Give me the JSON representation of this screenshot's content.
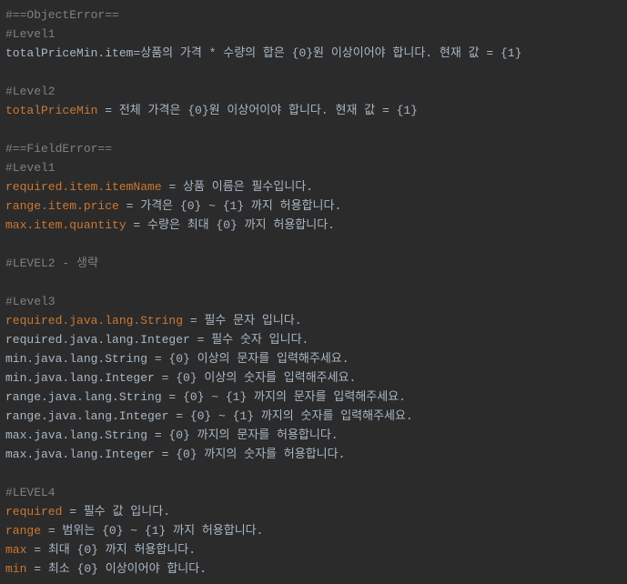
{
  "lines": [
    {
      "segments": [
        {
          "t": "#==ObjectError==",
          "c": "comment"
        }
      ]
    },
    {
      "segments": [
        {
          "t": "#Level1",
          "c": "comment"
        }
      ]
    },
    {
      "segments": [
        {
          "t": "totalPriceMin.item",
          "c": "string"
        },
        {
          "t": "=",
          "c": "string"
        },
        {
          "t": "상품의 가격 * 수량의 합은 {0}원 이상이어야 합니다. 현재 값 = {1}",
          "c": "string"
        }
      ]
    },
    {
      "segments": []
    },
    {
      "segments": [
        {
          "t": "#Level2",
          "c": "comment"
        }
      ]
    },
    {
      "segments": [
        {
          "t": "totalPriceMin",
          "c": "key"
        },
        {
          "t": " = ",
          "c": "string"
        },
        {
          "t": "전체 가격은 {0}원 이상어이야 합니다. 현재 값 = {1}",
          "c": "string"
        }
      ]
    },
    {
      "segments": []
    },
    {
      "segments": [
        {
          "t": "#==FieldError==",
          "c": "comment"
        }
      ]
    },
    {
      "segments": [
        {
          "t": "#Level1",
          "c": "comment"
        }
      ]
    },
    {
      "segments": [
        {
          "t": "required.item.itemName",
          "c": "key"
        },
        {
          "t": " = ",
          "c": "string"
        },
        {
          "t": "상품 이름은 필수입니다.",
          "c": "string"
        }
      ]
    },
    {
      "segments": [
        {
          "t": "range.item.price",
          "c": "key"
        },
        {
          "t": " = ",
          "c": "string"
        },
        {
          "t": "가격은 {0} ~ {1} 까지 허용합니다.",
          "c": "string"
        }
      ]
    },
    {
      "segments": [
        {
          "t": "max.item.quantity",
          "c": "key"
        },
        {
          "t": " = ",
          "c": "string"
        },
        {
          "t": "수량은 최대 {0} 까지 허용합니다.",
          "c": "string"
        }
      ]
    },
    {
      "segments": []
    },
    {
      "segments": [
        {
          "t": "#LEVEL2 - 생략",
          "c": "comment"
        }
      ]
    },
    {
      "segments": []
    },
    {
      "segments": [
        {
          "t": "#Level3",
          "c": "comment"
        }
      ]
    },
    {
      "segments": [
        {
          "t": "required.java.lang.String",
          "c": "key"
        },
        {
          "t": " = ",
          "c": "string"
        },
        {
          "t": "필수 문자 입니다.",
          "c": "string"
        }
      ]
    },
    {
      "segments": [
        {
          "t": "required.java.lang.Integer = 필수 숫자 입니다.",
          "c": "string"
        }
      ]
    },
    {
      "segments": [
        {
          "t": "min.java.lang.String = {0} 이상의 문자를 입력해주세요.",
          "c": "string"
        }
      ]
    },
    {
      "segments": [
        {
          "t": "min.java.lang.Integer = {0} 이상의 숫자를 입력해주세요.",
          "c": "string"
        }
      ]
    },
    {
      "segments": [
        {
          "t": "range.java.lang.String = {0} ~ {1} 까지의 문자를 입력해주세요.",
          "c": "string"
        }
      ]
    },
    {
      "segments": [
        {
          "t": "range.java.lang.Integer = {0} ~ {1} 까지의 숫자를 입력해주세요.",
          "c": "string"
        }
      ]
    },
    {
      "segments": [
        {
          "t": "max.java.lang.String = {0} 까지의 문자를 허용합니다.",
          "c": "string"
        }
      ]
    },
    {
      "segments": [
        {
          "t": "max.java.lang.Integer = {0} 까지의 숫자를 허용합니다.",
          "c": "string"
        }
      ]
    },
    {
      "segments": []
    },
    {
      "segments": [
        {
          "t": "#LEVEL4",
          "c": "comment"
        }
      ]
    },
    {
      "segments": [
        {
          "t": "required",
          "c": "key"
        },
        {
          "t": " = ",
          "c": "string"
        },
        {
          "t": "필수 값 입니다.",
          "c": "string"
        }
      ]
    },
    {
      "segments": [
        {
          "t": "range",
          "c": "key"
        },
        {
          "t": " = ",
          "c": "string"
        },
        {
          "t": "범위는 {0} ~ {1} 까지 허용합니다.",
          "c": "string"
        }
      ]
    },
    {
      "segments": [
        {
          "t": "max",
          "c": "key"
        },
        {
          "t": " = ",
          "c": "string"
        },
        {
          "t": "최대 {0} 까지 허용합니다.",
          "c": "string"
        }
      ]
    },
    {
      "segments": [
        {
          "t": "min",
          "c": "key"
        },
        {
          "t": " = ",
          "c": "string"
        },
        {
          "t": "최소 {0} 이상이어야 합니다.",
          "c": "string"
        }
      ]
    }
  ]
}
